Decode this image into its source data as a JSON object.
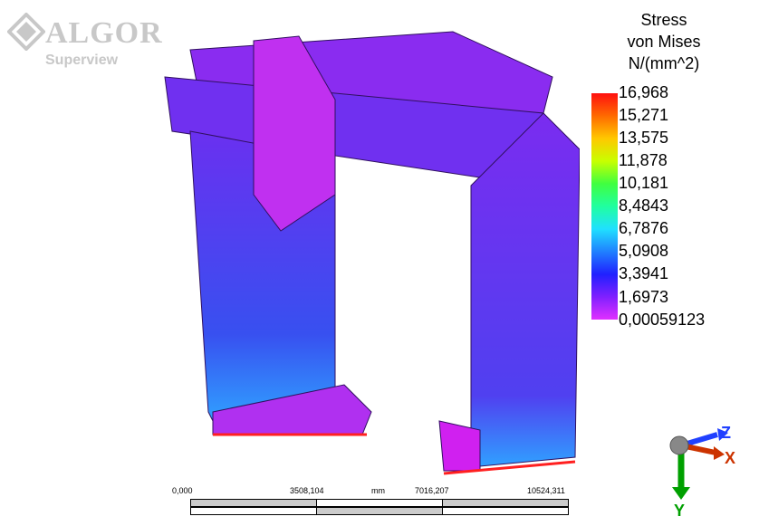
{
  "logo": {
    "brand": "ALGOR",
    "product": "Superview"
  },
  "legend": {
    "title_lines": [
      "Stress",
      "von Mises",
      "N/(mm^2)"
    ],
    "ticks": [
      "16,968",
      "15,271",
      "13,575",
      "11,878",
      "10,181",
      "8,4843",
      "6,7876",
      "5,0908",
      "3,3941",
      "1,6973",
      "0,00059123"
    ]
  },
  "scale_bar": {
    "labels": [
      "0,000",
      "3508,104",
      "mm",
      "7016,207",
      "10524,311"
    ]
  },
  "triad": {
    "axis_z": "Z",
    "axis_x": "X",
    "axis_y": "Y"
  },
  "colors": {
    "max": "#ff1010",
    "min": "#e030ff",
    "body": "#7a2cf0",
    "x_axis": "#cc3300",
    "y_axis": "#00a000",
    "z_axis": "#2040ff"
  }
}
